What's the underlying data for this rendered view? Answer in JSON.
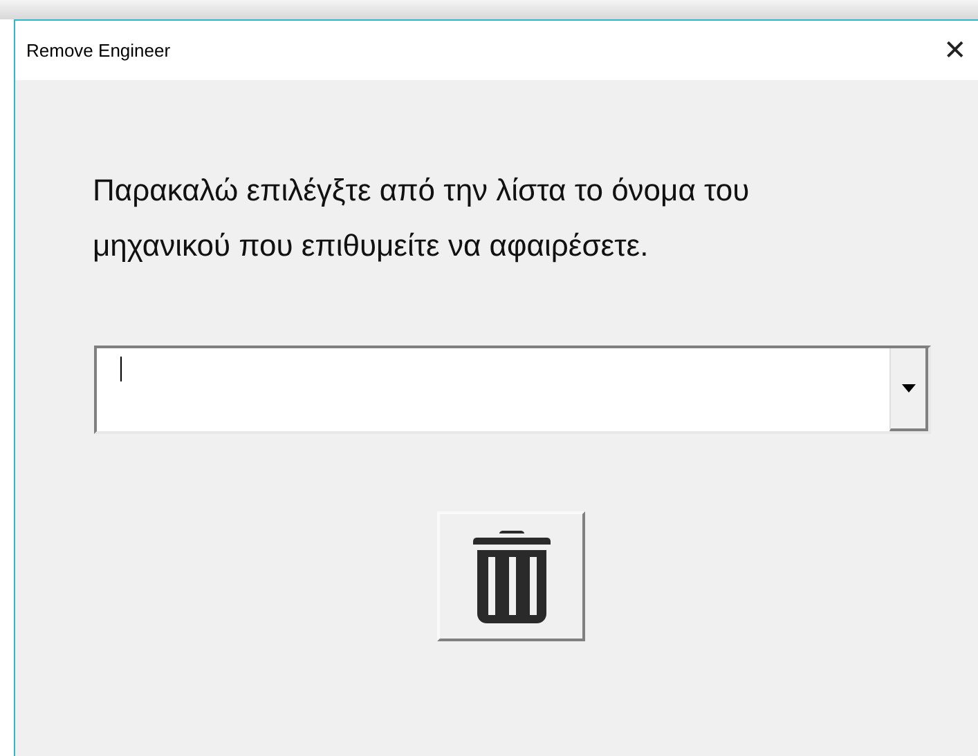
{
  "window": {
    "title": "Remove Engineer",
    "close": "✕"
  },
  "instruction": "Παρακαλώ επιλέγξτε από την λίστα το όνομα του μηχανικού που επιθυμείτε να αφαιρέσετε."
}
